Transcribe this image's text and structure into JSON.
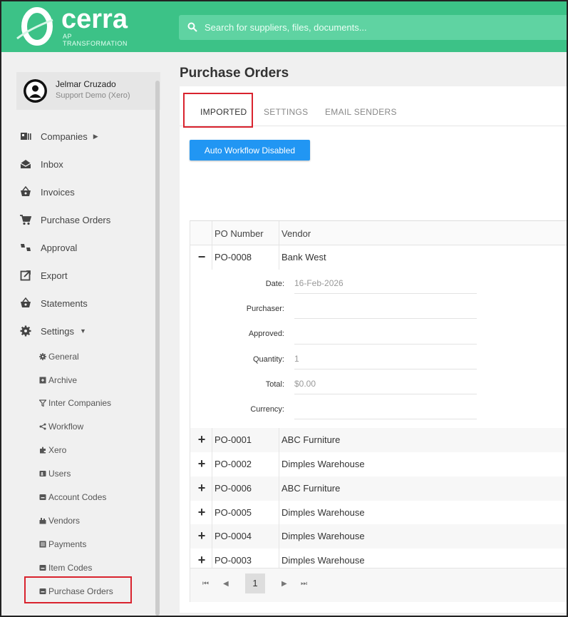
{
  "brand": {
    "name": "cerra",
    "tagline": "AP TRANSFORMATION"
  },
  "search": {
    "placeholder": "Search for suppliers, files, documents..."
  },
  "user": {
    "name": "Jelmar Cruzado",
    "org": "Support Demo (Xero)"
  },
  "nav": {
    "items": [
      {
        "label": "Companies",
        "icon": "companies-icon"
      },
      {
        "label": "Inbox",
        "icon": "inbox-icon"
      },
      {
        "label": "Invoices",
        "icon": "basket-icon"
      },
      {
        "label": "Purchase Orders",
        "icon": "cart-icon"
      },
      {
        "label": "Approval",
        "icon": "thumbs-icon"
      },
      {
        "label": "Export",
        "icon": "export-icon"
      },
      {
        "label": "Statements",
        "icon": "basket-icon"
      },
      {
        "label": "Settings",
        "icon": "gear-icon"
      }
    ],
    "settings_items": [
      {
        "label": "General",
        "icon": "gear-icon"
      },
      {
        "label": "Archive",
        "icon": "archive-icon"
      },
      {
        "label": "Inter Companies",
        "icon": "filter-icon"
      },
      {
        "label": "Workflow",
        "icon": "workflow-icon"
      },
      {
        "label": "Xero",
        "icon": "puzzle-icon"
      },
      {
        "label": "Users",
        "icon": "users-icon"
      },
      {
        "label": "Account Codes",
        "icon": "book-icon"
      },
      {
        "label": "Vendors",
        "icon": "vendors-icon"
      },
      {
        "label": "Payments",
        "icon": "list-icon"
      },
      {
        "label": "Item Codes",
        "icon": "book-icon"
      },
      {
        "label": "Purchase Orders",
        "icon": "book-icon"
      }
    ]
  },
  "page": {
    "title": "Purchase Orders"
  },
  "tabs": [
    "IMPORTED",
    "SETTINGS",
    "EMAIL SENDERS"
  ],
  "actions": {
    "auto_workflow": "Auto Workflow Disabled"
  },
  "grid": {
    "columns": [
      "PO Number",
      "Vendor"
    ],
    "expanded": {
      "po": "PO-0008",
      "vendor": "Bank West",
      "details": [
        {
          "label": "Date:",
          "value": "16-Feb-2026"
        },
        {
          "label": "Purchaser:",
          "value": ""
        },
        {
          "label": "Approved:",
          "value": ""
        },
        {
          "label": "Quantity:",
          "value": "1"
        },
        {
          "label": "Total:",
          "value": "$0.00"
        },
        {
          "label": "Currency:",
          "value": ""
        }
      ]
    },
    "rows": [
      {
        "po": "PO-0001",
        "vendor": "ABC Furniture"
      },
      {
        "po": "PO-0002",
        "vendor": "Dimples Warehouse"
      },
      {
        "po": "PO-0006",
        "vendor": "ABC Furniture"
      },
      {
        "po": "PO-0005",
        "vendor": "Dimples Warehouse"
      },
      {
        "po": "PO-0004",
        "vendor": "Dimples Warehouse"
      },
      {
        "po": "PO-0003",
        "vendor": "Dimples Warehouse"
      }
    ],
    "pager": {
      "page": "1"
    }
  },
  "colors": {
    "brand_green": "#3cc287",
    "button_blue": "#2196f3",
    "highlight_red": "#d9232e"
  }
}
